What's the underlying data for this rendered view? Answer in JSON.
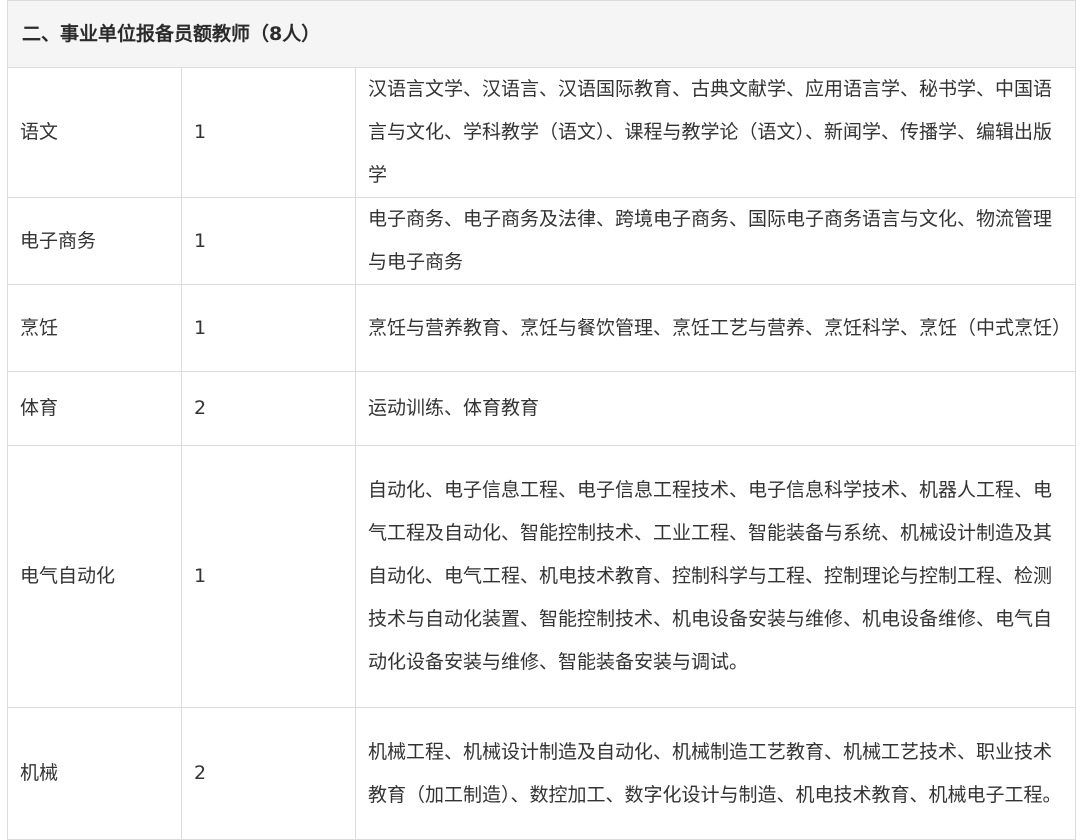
{
  "section_title": "二、事业单位报备员额教师（8人）",
  "rows": [
    {
      "subject": "语文",
      "count": "1",
      "majors": "汉语言文学、汉语言、汉语国际教育、古典文献学、应用语言学、秘书学、中国语言与文化、学科教学（语文）、课程与教学论（语文）、新闻学、传播学、编辑出版学"
    },
    {
      "subject": "电子商务",
      "count": "1",
      "majors": "电子商务、电子商务及法律、跨境电子商务、国际电子商务语言与文化、物流管理与电子商务"
    },
    {
      "subject": "烹饪",
      "count": "1",
      "majors": "烹饪与营养教育、烹饪与餐饮管理、烹饪工艺与营养、烹饪科学、烹饪（中式烹饪）"
    },
    {
      "subject": "体育",
      "count": "2",
      "majors": "运动训练、体育教育"
    },
    {
      "subject": "电气自动化",
      "count": "1",
      "majors": "自动化、电子信息工程、电子信息工程技术、电子信息科学技术、机器人工程、电气工程及自动化、智能控制技术、工业工程、智能装备与系统、机械设计制造及其自动化、电气工程、机电技术教育、控制科学与工程、控制理论与控制工程、检测技术与自动化装置、智能控制技术、机电设备安装与维修、机电设备维修、电气自动化设备安装与维修、智能装备安装与调试。"
    },
    {
      "subject": "机械",
      "count": "2",
      "majors": "机械工程、机械设计制造及自动化、机械制造工艺教育、机械工艺技术、职业技术教育（加工制造）、数控加工、数字化设计与制造、机电技术教育、机械电子工程。"
    }
  ]
}
